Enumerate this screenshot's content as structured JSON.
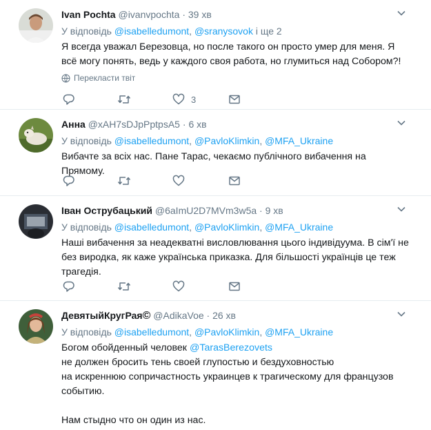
{
  "tweets": [
    {
      "name": "Ivan Pochta",
      "handle": "@ivanvpochta",
      "time": "39 хв",
      "reply_prefix": "У відповідь",
      "reply_mentions": [
        "@isabelledumont",
        "@sranysovok"
      ],
      "reply_suffix": "і ще 2",
      "body": [
        "Я всегда уважал Березовца, но после такого он просто умер для меня. Я всё могу понять, ведь у каждого своя работа, но глумиться над Собором?!"
      ],
      "translate": "Перекласти твіт",
      "like_count": "3"
    },
    {
      "name": "Анна",
      "handle": "@xAH7sDJpPptpsA5",
      "time": "6 хв",
      "reply_prefix": "У відповідь",
      "reply_mentions": [
        "@isabelledumont",
        "@PavloKlimkin",
        "@MFA_Ukraine"
      ],
      "body": [
        "Вибачте за всіх нас. Пане Тарас, чекаємо публічного вибачення на Прямому."
      ]
    },
    {
      "name": "Іван Острубацький",
      "handle": "@6aImU2D7MVm3w5a",
      "time": "9 хв",
      "reply_prefix": "У відповідь",
      "reply_mentions": [
        "@isabelledumont",
        "@PavloKlimkin",
        "@MFA_Ukraine"
      ],
      "body": [
        "Наші вибачення за неадекватні висловлювання цього індивідуума. В сім'ї не без виродка, як каже українська приказка. Для більшості українців це теж трагедія."
      ]
    },
    {
      "name": "ДевятыйКругРая",
      "name_badge": "©",
      "handle": "@AdikaVoe",
      "time": "26 хв",
      "reply_prefix": "У відповідь",
      "reply_mentions": [
        "@isabelledumont",
        "@PavloKlimkin",
        "@MFA_Ukraine"
      ],
      "body_prefix": "Богом обойденный человек",
      "body_mention": "@TarasBerezovets",
      "body_lines": [
        "не должен бросить тень своей глупостью и бездуховностью",
        "на искреннюю сопричастность украинцев к трагическому для французов событию.",
        "",
        "Нам стыдно что он один из нас."
      ]
    }
  ],
  "separators": {
    "dot": "·",
    "comma": ",",
    "space": " "
  },
  "colors": {
    "mention": "#1da1f2",
    "muted": "#657786",
    "text": "#14171a",
    "divider": "#e6ecf0"
  },
  "icons": [
    "chevron-down-icon",
    "reply-icon",
    "retweet-icon",
    "like-icon",
    "direct-message-icon",
    "globe-icon"
  ]
}
